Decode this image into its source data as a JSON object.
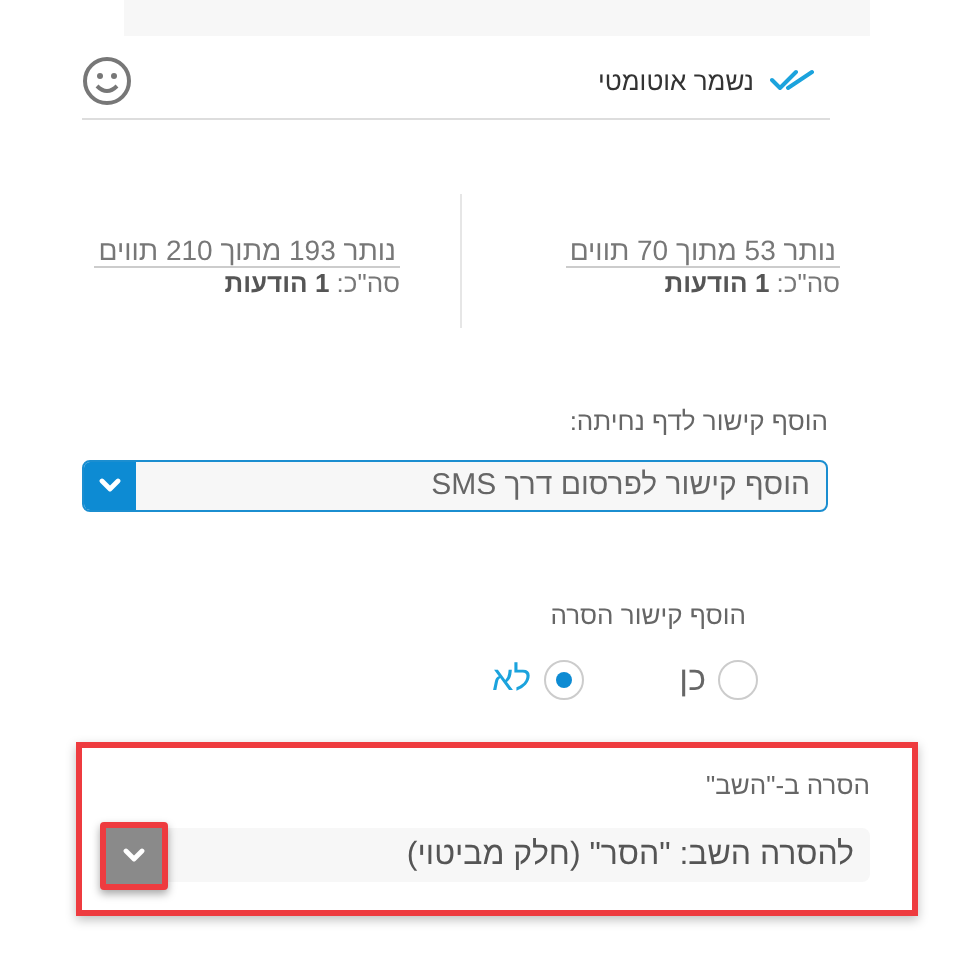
{
  "status": {
    "autosave_label": "נשמר אוטומטי"
  },
  "counters": [
    {
      "remaining": "נותר 53 מתוך 70 תווים",
      "total": "סה\"כ: **1 הודעות**"
    },
    {
      "remaining": "נותר 193 מתוך 210 תווים",
      "total": "סה\"כ: **1 הודעות**"
    }
  ],
  "landing_link": {
    "label": "הוסף קישור לדף נחיתה:",
    "value": "הוסף קישור לפרסום דרך SMS"
  },
  "removal_link": {
    "label": "הוסף קישור הסרה",
    "options": [
      {
        "label": "כן",
        "selected": false
      },
      {
        "label": "לא",
        "selected": true
      }
    ]
  },
  "reply_removal": {
    "label": "הסרה ב-\"השב\"",
    "value": "להסרה השב: \"הסר\" (חלק מביטוי)",
    "highlighted": true,
    "button_highlighted": true
  }
}
